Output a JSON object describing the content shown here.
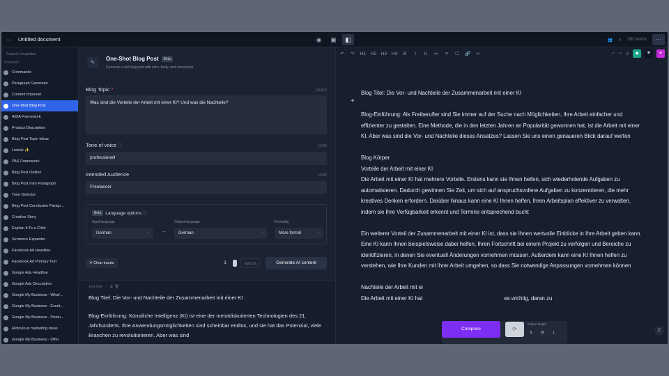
{
  "topbar": {
    "title": "Untitled document",
    "word_count": "392 words",
    "more": "···"
  },
  "sidebar": {
    "search_placeholder": "Search templates",
    "section": "Templates",
    "items": [
      "Commands",
      "Paragraph Generator",
      "Content Improver",
      "One-Shot Blog Post",
      "AIDA Framework",
      "Product Description",
      "Blog Post Topic Ideas",
      "Listicle ✨",
      "PAS Framework",
      "Blog Post Outline",
      "Blog Post Intro Paragraph",
      "Tone Detector",
      "Blog Post Conclusion Paragr...",
      "Creative Story",
      "Explain It To a Child",
      "Sentence Expander",
      "Facebook Ad Headline",
      "Facebook Ad Primary Text",
      "Google Ads Headline",
      "Google Ads Description",
      "Google My Business - What'...",
      "Google My Business - Event...",
      "Google My Business - Produ...",
      "Ridiculous marketing ideas",
      "Google My Business - Offer"
    ],
    "active_index": 3
  },
  "form": {
    "title": "One-Shot Blog Post",
    "badge": "Beta",
    "subtitle": "Generate a full blog post with intro, body, and conclusion.",
    "topic_label": "Blog Topic",
    "topic_required": "*",
    "topic_count": "69/600",
    "topic_value": "Was sind die Vorteile der Arbeit mit einer KI? Und was die Nachteile?",
    "tone_label": "Tone of voice",
    "tone_count": "12/80",
    "tone_value": "professionell",
    "audience_label": "Intended Audience",
    "audience_count": "10/85",
    "audience_value": "Freelancer",
    "lang_badge": "Beta",
    "lang_label": "Language options",
    "input_lang_label": "Input language",
    "input_lang": "German",
    "output_lang_label": "Output language",
    "output_lang": "German",
    "formality_label": "Formality",
    "formality": "More formal",
    "clear_label": "Clear inputs",
    "outputs_count": "3",
    "outputs_label": "outputs",
    "generate_label": "Generate AI content"
  },
  "output": {
    "meta": "Just now",
    "title": "Blog Titel: Die Vor- und Nachteile der Zusammenarbeit mit einer KI",
    "body": "Blog-Einführung: Künstliche Intelligenz (KI) ist eine der meistdiskutierten Technologien des 21. Jahrhunderts. Ihre Anwendungsmöglichkeiten sind scheinbar endlos, und sie hat das Potenzial, viele Branchen zu revolutionieren. Aber was sind"
  },
  "editor": {
    "toolbar": [
      "↶",
      "↷",
      "H1",
      "H2",
      "H3",
      "H4",
      "B",
      "I",
      "U",
      "≔",
      "≡",
      "☐",
      "🔗",
      "✂"
    ],
    "paragraphs": [
      "Blog Titel: Die Vor- und Nachteile der Zusammenarbeit mit einer KI",
      "Blog-Einführung: Als Freiberufler sind Sie immer auf der Suche nach Möglichkeiten, Ihre Arbeit einfacher und effizienter zu gestalten. Eine Methode, die in den letzten Jahren an Popularität gewonnen hat, ist die Arbeit mit einer KI. Aber was sind die Vor- und Nachteile dieses Ansatzes? Lassen Sie uns einen genaueren Blick darauf werfen",
      "Blog Körper\nVorteile der Arbeit mit einer KI\nDie Arbeit mit einer KI hat mehrere Vorteile. Erstens kann sie Ihnen helfen, sich wiederholende Aufgaben zu automatisieren. Dadurch gewinnen Sie Zeit, um sich auf anspruchsvollere Aufgaben zu konzentrieren, die mehr kreatives Denken erfordern. Darüber hinaus kann eine KI Ihnen helfen, Ihren Arbeitsplan effektiver zu verwalten, indem sie Ihre Verfügbarkeit erkennt und Termine entsprechend bucht",
      "Ein weiterer Vorteil der Zusammenarbeit mit einer KI ist, dass sie Ihnen wertvolle Einblicke in Ihre Arbeit geben kann. Eine KI kann Ihnen beispielsweise dabei helfen, Ihren Fortschritt bei einem Projekt zu verfolgen und Bereiche zu identifizieren, in denen Sie eventuell Änderungen vornehmen müssen. Außerdem kann eine KI Ihnen helfen zu verstehen, wie Ihre Kunden mit Ihrer Arbeit umgehen, so dass Sie notwendige Anpassungen vornehmen können",
      "Nachteile der Arbeit mit ei\nDie Arbeit mit einer KI hat                                                      es wichtig, daran zu"
    ],
    "compose_label": "Compose",
    "output_length_label": "Output length",
    "lengths": [
      "S",
      "M",
      "L"
    ],
    "corner": "C"
  }
}
